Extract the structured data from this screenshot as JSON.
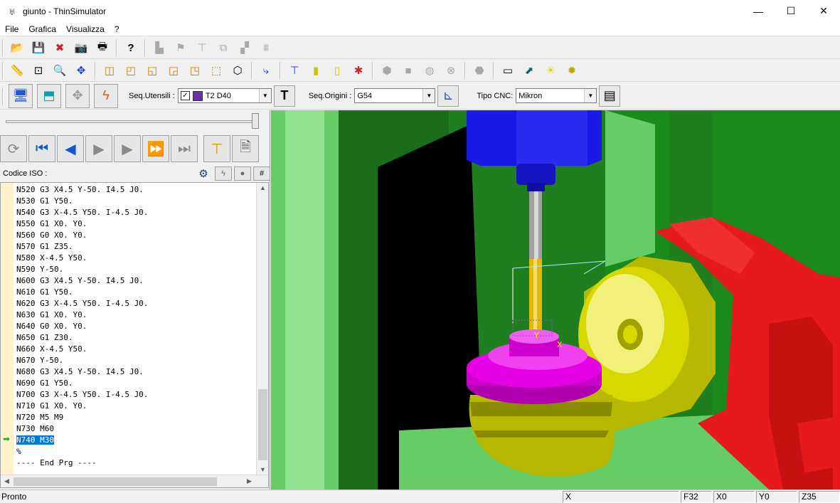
{
  "window": {
    "title": "giunto - ThinSimulator",
    "minimize": "—",
    "maximize": "☐",
    "close": "✕"
  },
  "menu": [
    "File",
    "Grafica",
    "Visualizza",
    "?"
  ],
  "toolbar3": {
    "seq_utensili_label": "Seq.Utensili :",
    "tool_checked": "✓",
    "tool_value": "T2 D40",
    "seq_origini_label": "Seq.Origini :",
    "origin_value": "G54",
    "tipo_cnc_label": "Tipo CNC:",
    "cnc_value": "Mikron"
  },
  "left_panel": {
    "codice_label": "Codice ISO :",
    "code_lines": [
      "N520 G3 X4.5 Y-50. I4.5 J0.",
      "N530 G1 Y50.",
      "N540 G3 X-4.5 Y50. I-4.5 J0.",
      "N550 G1 X0. Y0.",
      "N560 G0 X0. Y0.",
      "N570 G1 Z35.",
      "N580 X-4.5 Y50.",
      "N590 Y-50.",
      "N600 G3 X4.5 Y-50. I4.5 J0.",
      "N610 G1 Y50.",
      "N620 G3 X-4.5 Y50. I-4.5 J0.",
      "N630 G1 X0. Y0.",
      "N640 G0 X0. Y0.",
      "N650 G1 Z30.",
      "N660 X-4.5 Y50.",
      "N670 Y-50.",
      "N680 G3 X4.5 Y-50. I4.5 J0.",
      "N690 G1 Y50.",
      "N700 G3 X-4.5 Y50. I-4.5 J0.",
      "N710 G1 X0. Y0.",
      "N720 M5 M9",
      "N730 M60",
      "N740 M30",
      "%",
      "---- End Prg ----"
    ],
    "selected_line_index": 22
  },
  "statusbar": {
    "status": "Pronto",
    "x_label": "X",
    "feed": "F32",
    "x": "X0",
    "y": "Y0",
    "z": "Z35"
  },
  "colors": {
    "spindle": "#1a1ae6",
    "workpiece": "#e600e6",
    "fixture": "#c8c800",
    "vise": "#e61a1a",
    "machine_bg": "#1f7f1f",
    "light_green": "#66cc66",
    "highlight": "#0078d7"
  }
}
